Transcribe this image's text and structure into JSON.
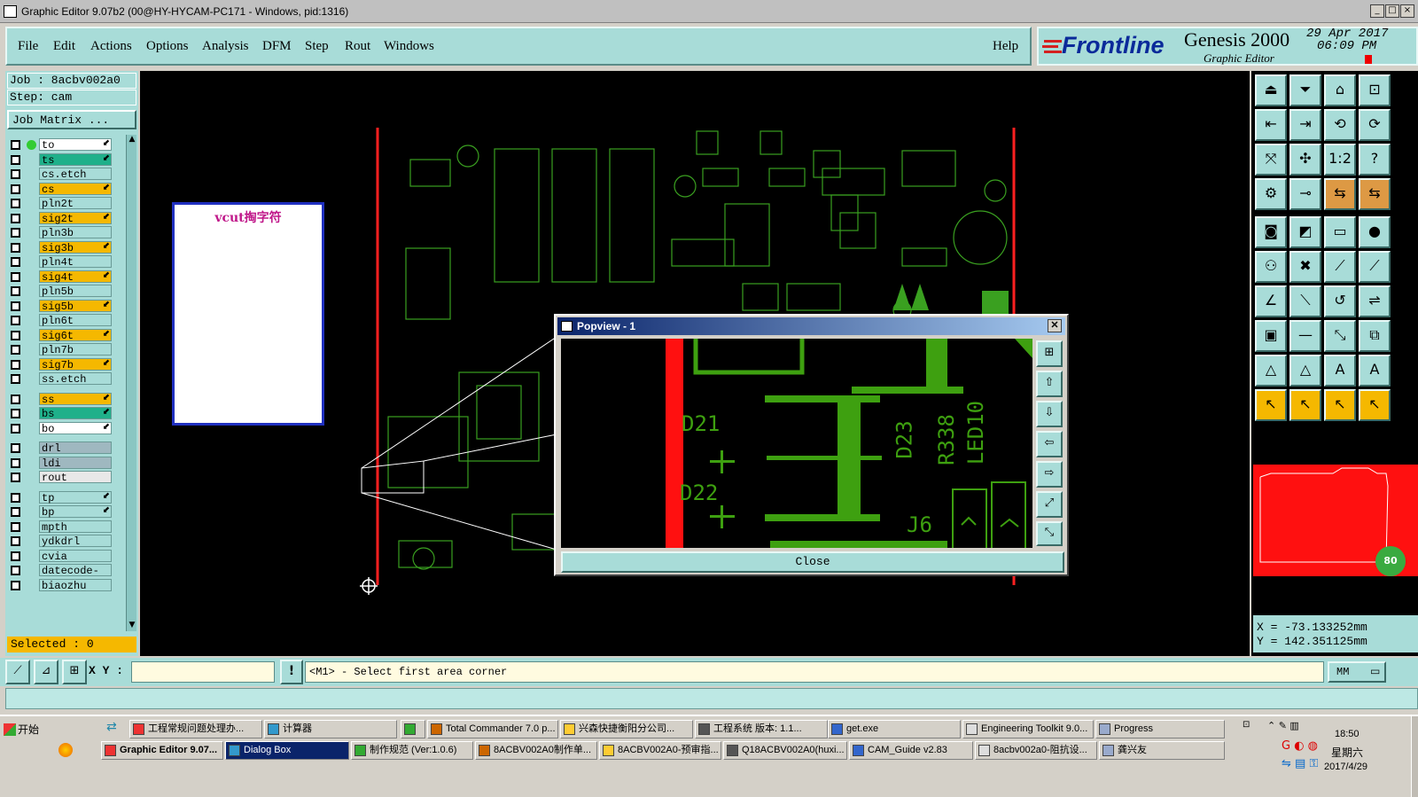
{
  "window": {
    "title": "Graphic Editor 9.07b2 (00@HY-HYCAM-PC171 - Windows, pid:1316)"
  },
  "menu": [
    "File",
    "Edit",
    "Actions",
    "Options",
    "Analysis",
    "DFM",
    "Step",
    "Rout",
    "Windows"
  ],
  "help_label": "Help",
  "brand": {
    "logo": "Frontline",
    "product": "Genesis 2000",
    "subtitle": "Graphic Editor",
    "date": "29 Apr 2017",
    "time": "06:09 PM"
  },
  "job": {
    "job_line": "Job : 8acbv002a0",
    "step_line": "Step: cam",
    "matrix_button": "Job Matrix ..."
  },
  "layers": [
    {
      "name": "to",
      "color": "#ffffff"
    },
    {
      "name": "ts",
      "color": "#1fb08a"
    },
    {
      "name": "cs.etch",
      "color": "#a8dcd8"
    },
    {
      "name": "cs",
      "color": "#f5b800"
    },
    {
      "name": "pln2t",
      "color": "#a8dcd8"
    },
    {
      "name": "sig2t",
      "color": "#f5b800"
    },
    {
      "name": "pln3b",
      "color": "#a8dcd8"
    },
    {
      "name": "sig3b",
      "color": "#f5b800"
    },
    {
      "name": "pln4t",
      "color": "#a8dcd8"
    },
    {
      "name": "sig4t",
      "color": "#f5b800"
    },
    {
      "name": "pln5b",
      "color": "#a8dcd8"
    },
    {
      "name": "sig5b",
      "color": "#f5b800"
    },
    {
      "name": "pln6t",
      "color": "#a8dcd8"
    },
    {
      "name": "sig6t",
      "color": "#f5b800"
    },
    {
      "name": "pln7b",
      "color": "#a8dcd8"
    },
    {
      "name": "sig7b",
      "color": "#f5b800"
    },
    {
      "name": "ss.etch",
      "color": "#a8dcd8"
    },
    {
      "name": "ss",
      "color": "#f5b800"
    },
    {
      "name": "bs",
      "color": "#1fb08a"
    },
    {
      "name": "bo",
      "color": "#ffffff"
    },
    {
      "name": "drl",
      "color": "#9fb8c0"
    },
    {
      "name": "ldi",
      "color": "#9fb8c0"
    },
    {
      "name": "rout",
      "color": "#e8e8e8"
    },
    {
      "name": "tp",
      "color": "#a8dcd8"
    },
    {
      "name": "bp",
      "color": "#a8dcd8"
    },
    {
      "name": "mpth",
      "color": "#a8dcd8"
    },
    {
      "name": "ydkdrl",
      "color": "#a8dcd8"
    },
    {
      "name": "cvia",
      "color": "#a8dcd8"
    },
    {
      "name": "datecode-pt",
      "color": "#a8dcd8"
    },
    {
      "name": "biaozhu",
      "color": "#a8dcd8"
    }
  ],
  "selected": "Selected : 0",
  "note_box": {
    "text": "vcut掏字符"
  },
  "popview": {
    "title": "Popview - 1",
    "close_label": "Close",
    "designators": [
      "D21",
      "D22",
      "D23",
      "R338",
      "LED10",
      "J6"
    ]
  },
  "coords": {
    "x": "X = -73.133252mm",
    "y": "Y = 142.351125mm"
  },
  "xy_label": "X Y :",
  "xy_input": "",
  "prompt": "<M1> - Select first area corner",
  "units": "MM",
  "start_label": "开始",
  "taskbar_row1": [
    "工程常规问题处理办...",
    "计算器",
    "",
    "Total Commander 7.0 p...",
    "兴森快捷衡阳分公司...",
    "工程系统  版本: 1.1...",
    "get.exe",
    "Engineering Toolkit 9.0...",
    "Progress"
  ],
  "taskbar_row2": [
    "Graphic Editor 9.07...",
    "Dialog Box",
    "制作规范 (Ver:1.0.6)",
    "8ACBV002A0制作单...",
    "8ACBV002A0-预审指...",
    "Q18ACBV002A0(huxi...",
    "CAM_Guide v2.83",
    "8acbv002a0-阻抗设...",
    "龚兴友"
  ],
  "clock": {
    "time": "18:50",
    "day": "星期六",
    "date": "2017/4/29"
  },
  "zoom_badge": "80"
}
